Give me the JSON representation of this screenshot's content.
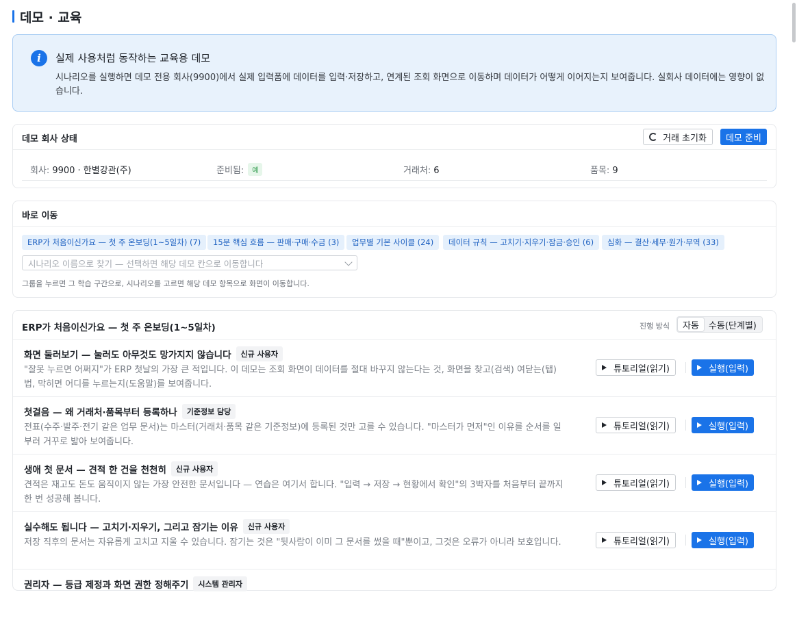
{
  "page_title": "데모 · 교육",
  "info": {
    "title": "실제 사용처럼 동작하는 교육용 데모",
    "body": "시나리오를 실행하면 데모 전용 회사(9900)에서 실제 입력폼에 데이터를 입력·저장하고, 연계된 조회 화면으로 이동하며 데이터가 어떻게 이어지는지 보여줍니다. 실회사 데이터에는 영향이 없습니다."
  },
  "status": {
    "title": "데모 회사 상태",
    "reset_label": "거래 초기화",
    "prepare_label": "데모 준비",
    "company_label": "회사:",
    "company_value": "9900 · 한별강관(주)",
    "ready_label": "준비됨:",
    "ready_value": "예",
    "customers_label": "거래처:",
    "customers_value": "6",
    "items_label": "품목:",
    "items_value": "9"
  },
  "jump": {
    "title": "바로 이동",
    "chips": [
      "ERP가 처음이신가요 — 첫 주 온보딩(1~5일차) (7)",
      "15분 핵심 흐름 — 판매·구매·수금 (3)",
      "업무별 기본 사이클 (24)",
      "데이터 규칙 — 고치기·지우기·잠금·승인 (6)",
      "심화 — 결산·세무·원가·무역 (33)"
    ],
    "select_placeholder": "시나리오 이름으로 찾기 — 선택하면 해당 데모 칸으로 이동합니다",
    "hint": "그룹을 누르면 그 학습 구간으로, 시나리오를 고르면 해당 데모 항목으로 화면이 이동합니다."
  },
  "onboarding": {
    "title": "ERP가 처음이신가요 — 첫 주 온보딩(1~5일차)",
    "mode_label": "진행 방식",
    "mode_auto": "자동",
    "mode_manual": "수동(단계별)",
    "tutorial_label": "튜토리얼(읽기)",
    "run_label": "실행(입력)",
    "scenarios": [
      {
        "title": "화면 둘러보기 — 눌러도 아무것도 망가지지 않습니다",
        "tag": "신규 사용자",
        "desc": "\"잘못 누르면 어쩌지\"가 ERP 첫날의 가장 큰 적입니다. 이 데모는 조회 화면이 데이터를 절대 바꾸지 않는다는 것, 화면을 찾고(검색) 여닫는(탭) 법, 막히면 어디를 누르는지(도움말)를 보여줍니다."
      },
      {
        "title": "첫걸음 — 왜 거래처·품목부터 등록하나",
        "tag": "기준정보 담당",
        "desc": "전표(수주·발주·전기 같은 업무 문서)는 마스터(거래처·품목 같은 기준정보)에 등록된 것만 고를 수 있습니다. \"마스터가 먼저\"인 이유를 순서를 일부러 거꾸로 밟아 보여줍니다."
      },
      {
        "title": "생애 첫 문서 — 견적 한 건을 천천히",
        "tag": "신규 사용자",
        "desc": "견적은 재고도 돈도 움직이지 않는 가장 안전한 문서입니다 — 연습은 여기서 합니다. \"입력 → 저장 → 현황에서 확인\"의 3박자를 처음부터 끝까지 한 번 성공해 봅니다."
      },
      {
        "title": "실수해도 됩니다 — 고치기·지우기, 그리고 잠기는 이유",
        "tag": "신규 사용자",
        "desc": "저장 직후의 문서는 자유롭게 고치고 지울 수 있습니다. 잠기는 것은 \"뒷사람이 이미 그 문서를 썼을 때\"뿐이고, 그것은 오류가 아니라 보호입니다."
      },
      {
        "title": "권리자 — 등급 제정과 화면 권한 정해주기",
        "tag": "시스템 관리자",
        "desc": ""
      }
    ]
  },
  "colors": {
    "accent": "#1a73e8",
    "info_bg": "#e8f2fc",
    "chip_bg": "#e5f0fc",
    "ready_badge": "#2f9a4c"
  }
}
